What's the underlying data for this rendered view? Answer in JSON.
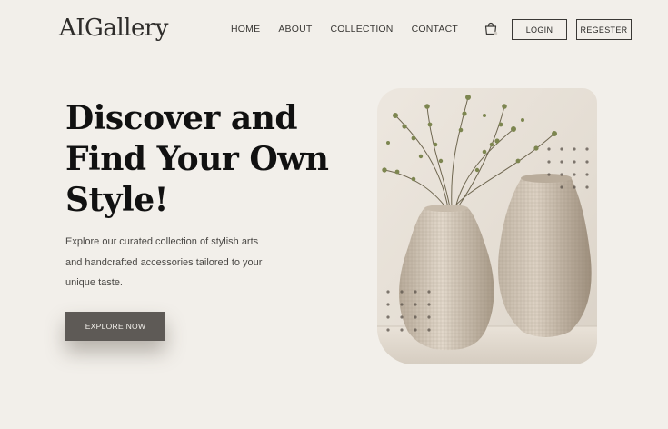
{
  "brand": {
    "logo": "AIGallery"
  },
  "nav": {
    "items": [
      {
        "label": "HOME"
      },
      {
        "label": "ABOUT"
      },
      {
        "label": "COLLECTION"
      },
      {
        "label": "CONTACT"
      }
    ]
  },
  "header": {
    "cart_icon": "shopping-bag-icon",
    "login_label": "LOGIN",
    "register_label": "REGESTER"
  },
  "hero": {
    "headline_line1": "Discover and",
    "headline_line2": "Find Your Own",
    "headline_line3": "Style!",
    "description_line1": "Explore our curated collection of stylish arts",
    "description_line2": "and handcrafted accessories tailored to your",
    "description_line3": "unique taste.",
    "cta_label": "EXPLORE NOW"
  },
  "colors": {
    "background": "#f2efea",
    "button_dark": "#5e5a56",
    "text_dark": "#111111"
  }
}
